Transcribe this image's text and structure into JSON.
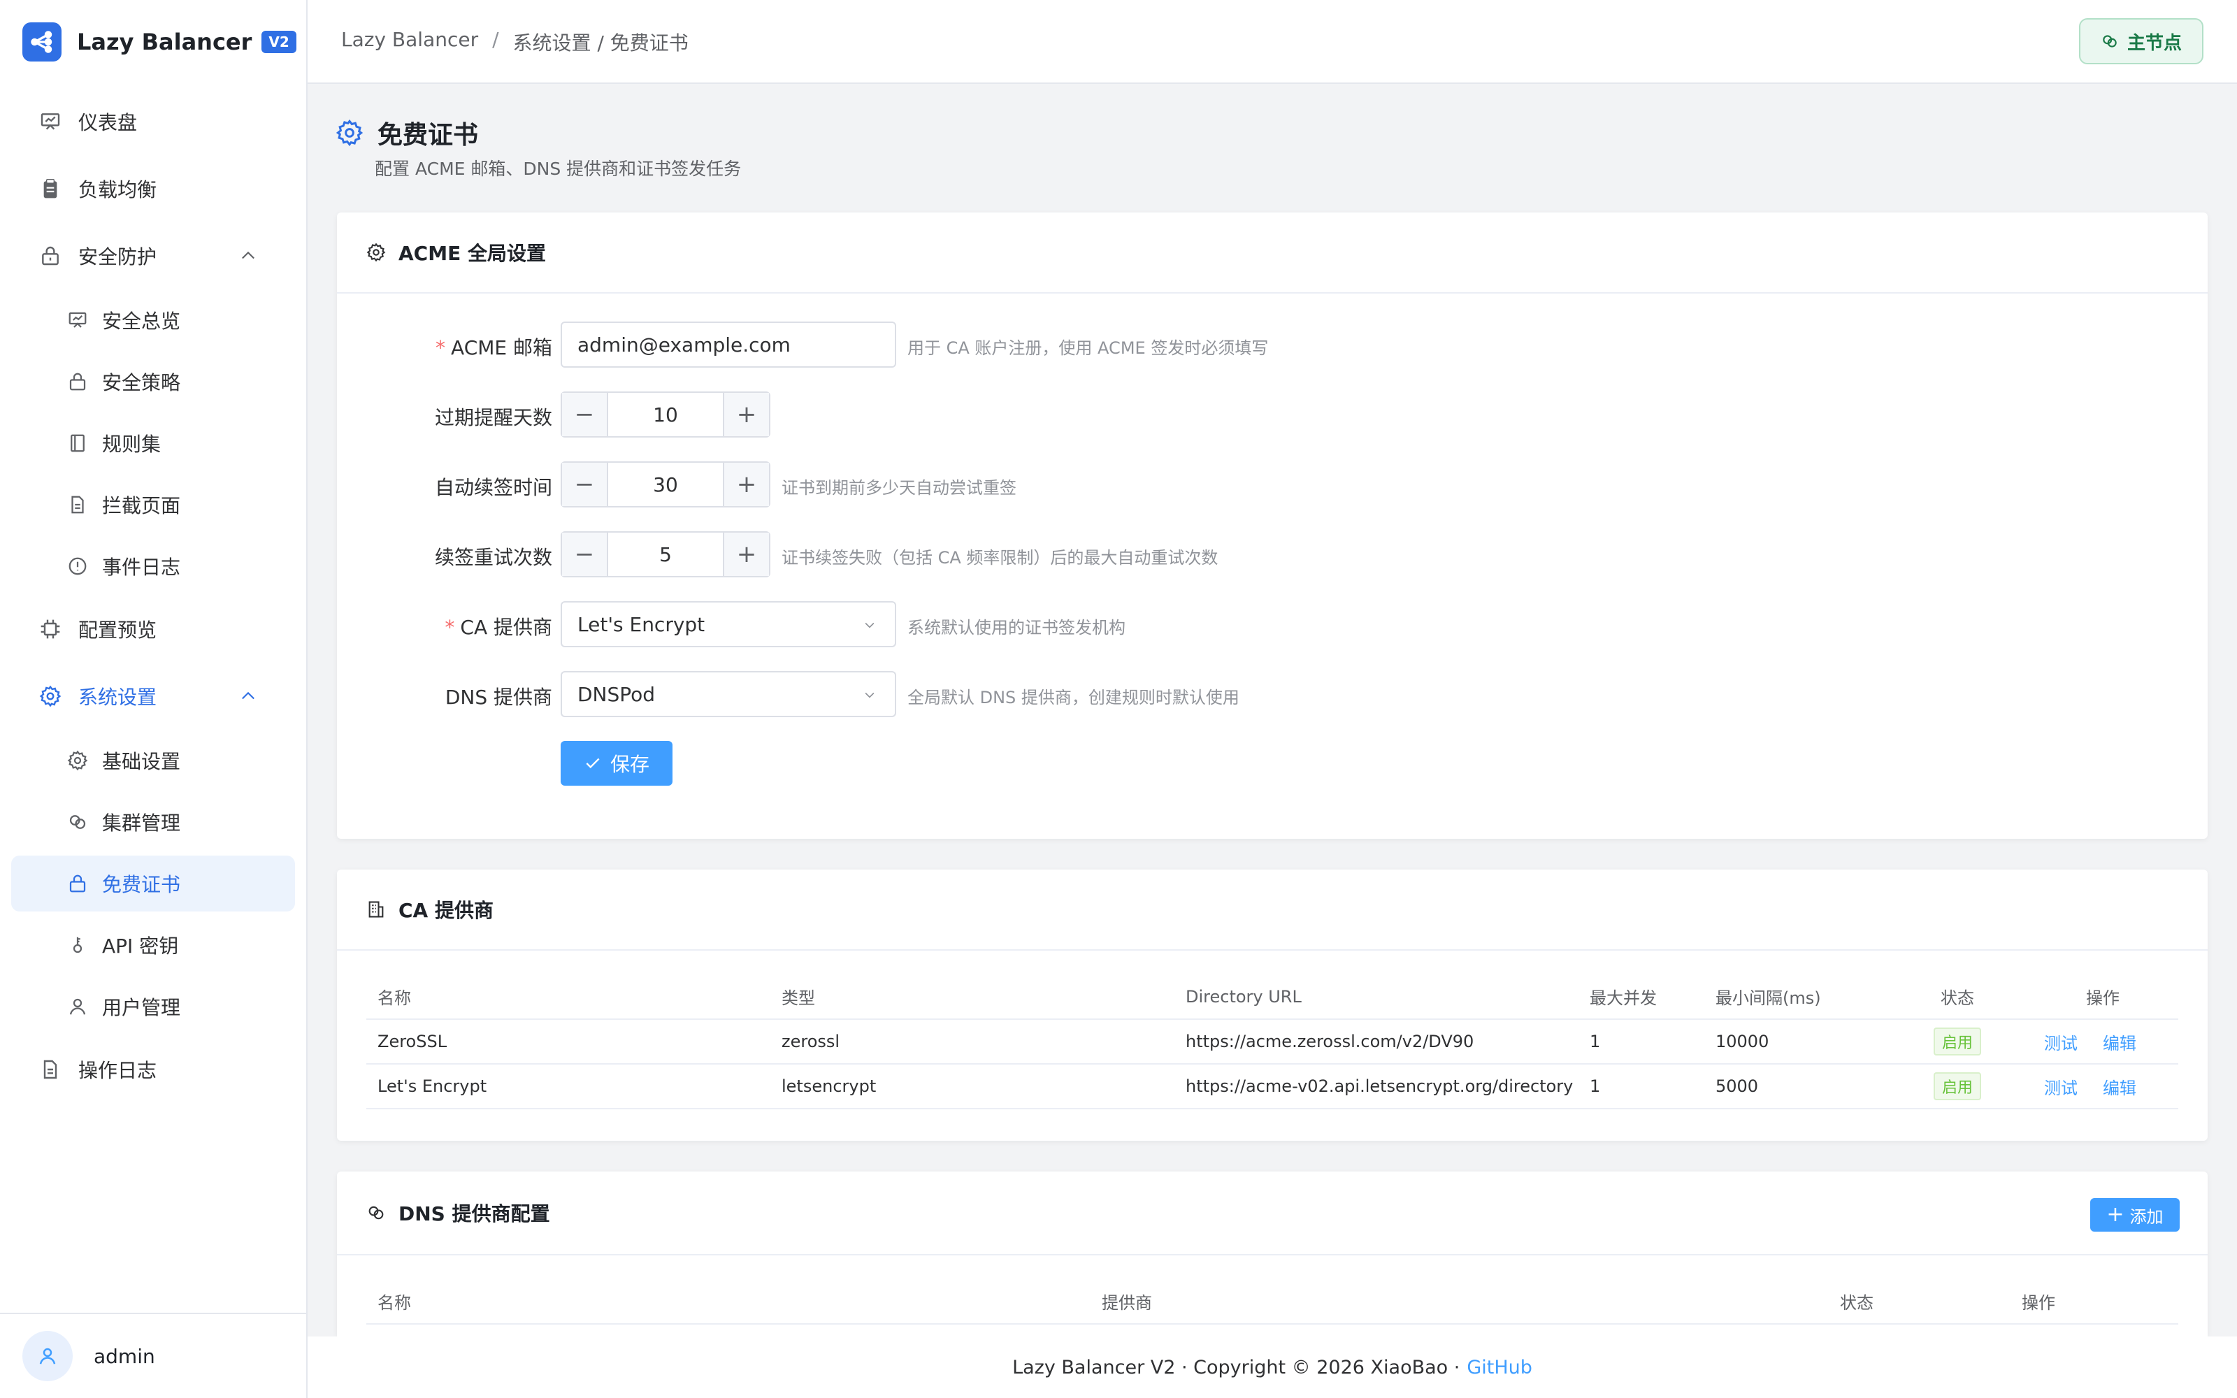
{
  "app": {
    "name": "Lazy Balancer",
    "version_badge": "V2"
  },
  "sidebar": {
    "items": [
      {
        "label": "仪表盘",
        "icon": "dashboard-icon"
      },
      {
        "label": "负载均衡",
        "icon": "clipboard-icon"
      },
      {
        "label": "安全防护",
        "icon": "lock-icon"
      },
      {
        "label": "安全总览",
        "icon": "dashboard-icon"
      },
      {
        "label": "安全策略",
        "icon": "lock-icon"
      },
      {
        "label": "规则集",
        "icon": "notebook-icon"
      },
      {
        "label": "拦截页面",
        "icon": "document-icon"
      },
      {
        "label": "事件日志",
        "icon": "warning-circle-icon"
      },
      {
        "label": "配置预览",
        "icon": "cpu-icon"
      },
      {
        "label": "系统设置",
        "icon": "gear-icon"
      },
      {
        "label": "基础设置",
        "icon": "gear-icon"
      },
      {
        "label": "集群管理",
        "icon": "link-icon"
      },
      {
        "label": "免费证书",
        "icon": "lock-icon"
      },
      {
        "label": "API 密钥",
        "icon": "key-icon"
      },
      {
        "label": "用户管理",
        "icon": "user-icon"
      },
      {
        "label": "操作日志",
        "icon": "document-icon"
      }
    ],
    "user": "admin"
  },
  "header": {
    "breadcrumb": [
      "Lazy Balancer",
      "/",
      "系统设置 / 免费证书"
    ],
    "node_button": "主节点"
  },
  "page": {
    "title": "免费证书",
    "subtitle": "配置 ACME 邮箱、DNS 提供商和证书签发任务"
  },
  "acme": {
    "title": "ACME 全局设置",
    "email_label": "ACME 邮箱",
    "email_value": "admin@example.com",
    "email_hint": "用于 CA 账户注册，使用 ACME 签发时必须填写",
    "expire_label": "过期提醒天数",
    "expire_value": "10",
    "renew_label": "自动续签时间",
    "renew_value": "30",
    "renew_hint": "证书到期前多少天自动尝试重签",
    "retry_label": "续签重试次数",
    "retry_value": "5",
    "retry_hint": "证书续签失败（包括 CA 频率限制）后的最大自动重试次数",
    "ca_label": "CA 提供商",
    "ca_value": "Let's Encrypt",
    "ca_hint": "系统默认使用的证书签发机构",
    "dns_label": "DNS 提供商",
    "dns_value": "DNSPod",
    "dns_hint": "全局默认 DNS 提供商，创建规则时默认使用",
    "save": "保存"
  },
  "ca_providers": {
    "title": "CA 提供商",
    "headers": [
      "名称",
      "类型",
      "Directory URL",
      "最大并发",
      "最小间隔(ms)",
      "状态",
      "操作"
    ],
    "rows": [
      {
        "name": "ZeroSSL",
        "type": "zerossl",
        "url": "https://acme.zerossl.com/v2/DV90",
        "concurrency": "1",
        "interval": "10000",
        "status": "启用",
        "test": "测试",
        "edit": "编辑"
      },
      {
        "name": "Let's Encrypt",
        "type": "letsencrypt",
        "url": "https://acme-v02.api.letsencrypt.org/directory",
        "concurrency": "1",
        "interval": "5000",
        "status": "启用",
        "test": "测试",
        "edit": "编辑"
      }
    ]
  },
  "dns_providers": {
    "title": "DNS 提供商配置",
    "add": "添加",
    "headers": [
      "名称",
      "提供商",
      "状态",
      "操作"
    ]
  },
  "footer": {
    "text": "Lazy Balancer V2 · Copyright © 2026 XiaoBao ·",
    "link": "GitHub"
  },
  "colors": {
    "primary": "#409eff",
    "brand": "#2f6fe4",
    "success": "#67c23a",
    "required": "#f56c6c"
  }
}
